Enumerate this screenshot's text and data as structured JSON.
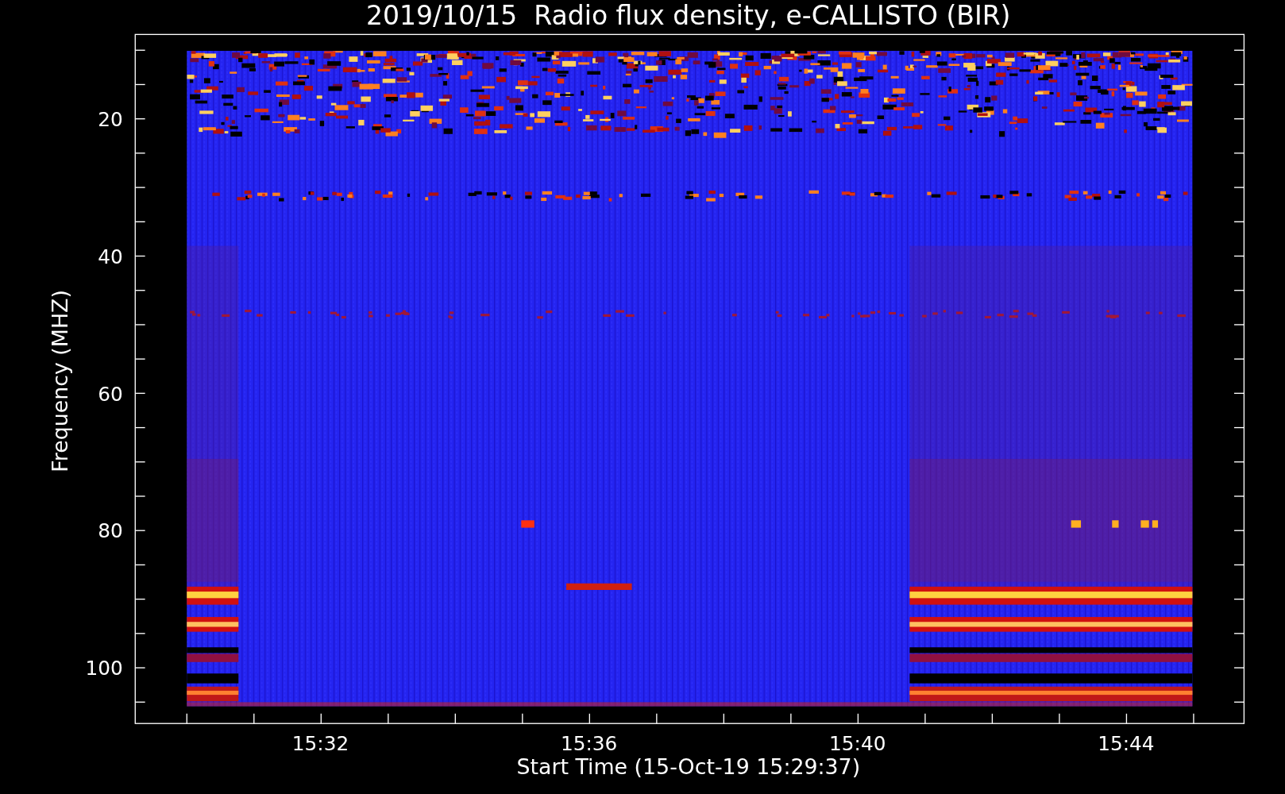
{
  "title": "2019/10/15  Radio flux density, e-CALLISTO (BIR)",
  "y_axis": {
    "label": "Frequency (MHZ)",
    "ticks": [
      "20",
      "40",
      "60",
      "80",
      "100"
    ]
  },
  "x_axis": {
    "label": "Start Time (15-Oct-19 15:29:37)",
    "ticks": [
      "15:32",
      "15:36",
      "15:40",
      "15:44"
    ]
  }
}
